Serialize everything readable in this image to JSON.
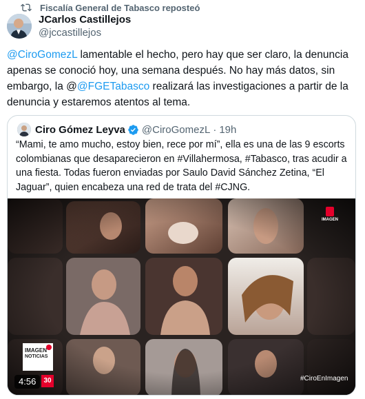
{
  "repost_label": "Fiscalía General de Tabasco reposteó",
  "author": {
    "name": "JCarlos Castillejos",
    "handle": "@jccastillejos"
  },
  "tweet": {
    "mention1": "@CiroGomezL",
    "part1": " lamentable el hecho, pero hay que ser claro, la denuncia apenas se conoció hoy, una semana después. No hay más datos, sin embargo, la @",
    "mention2": "@FGETabasco",
    "part2": " realizará las investigaciones a partir de la denuncia y estaremos atentos al tema."
  },
  "quote": {
    "name": "Ciro Gómez Leyva",
    "handle": "@CiroGomezL",
    "sep": "·",
    "time": "19h",
    "text": "“Mami, te amo mucho, estoy bien, rece por mí”, ella es una de las 9 escorts colombianas que desaparecieron en #Villahermosa, #Tabasco, tras acudir a una fiesta. Todas fueron enviadas por Saulo David Sánchez Zetina, “El Jaguar”, quien encabeza una red de trata del #CJNG."
  },
  "video": {
    "brand": "IMAGEN",
    "logo_line1": "IMAGEN",
    "logo_line2": "NOTICIAS",
    "duration": "4:56",
    "badge": "30",
    "hashtag": "#CiroEnImagen"
  },
  "colors": {
    "accent": "#1d9bf0",
    "verified": "#1d9bf0",
    "media_bg": "#1e1a1a",
    "brand_red": "#e4002b"
  }
}
